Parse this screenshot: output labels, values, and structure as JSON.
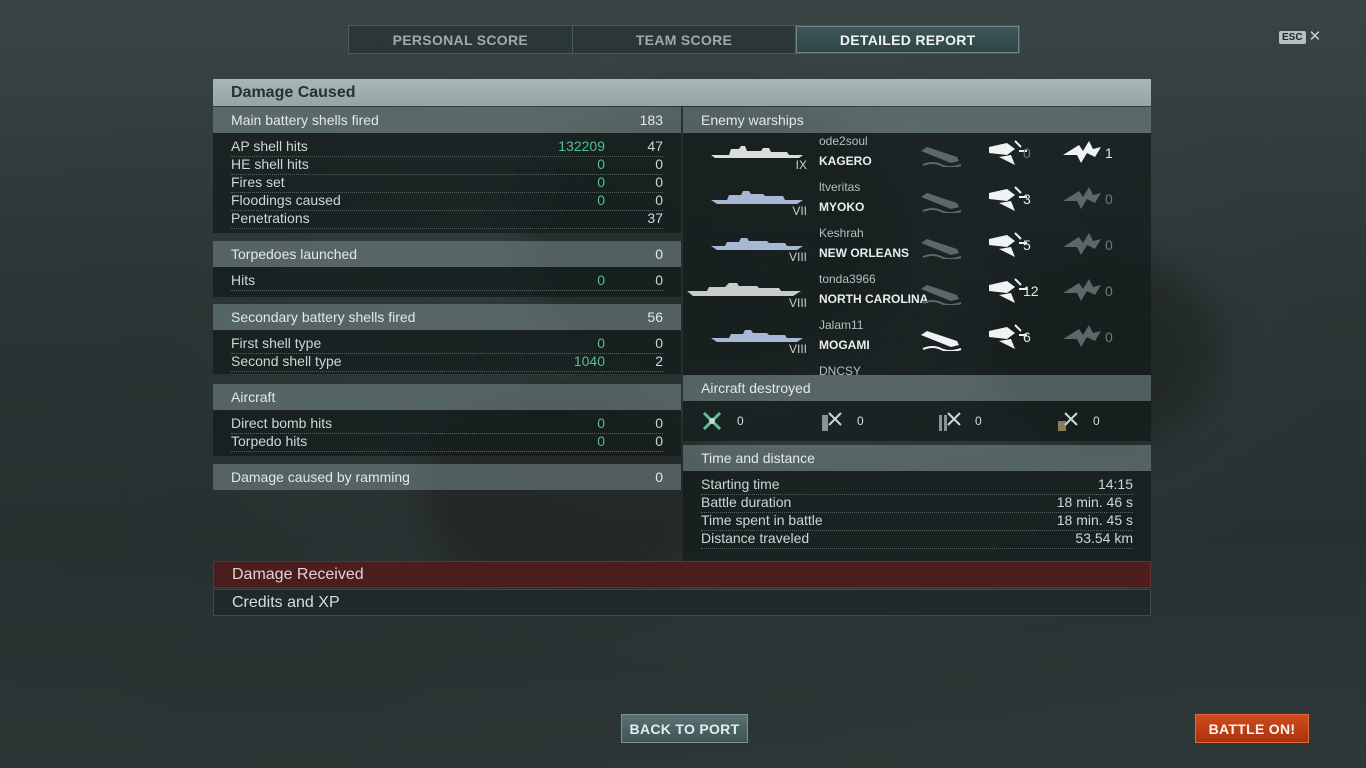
{
  "tabs": [
    "PERSONAL SCORE",
    "TEAM SCORE",
    "DETAILED REPORT"
  ],
  "esc": {
    "key": "ESC",
    "close": "✕"
  },
  "damage_caused": {
    "title": "Damage Caused",
    "main_battery": {
      "header": {
        "label": "Main battery shells fired",
        "value": "183"
      },
      "rows": [
        {
          "label": "AP shell hits",
          "green": "132209",
          "value": "47"
        },
        {
          "label": "HE shell hits",
          "green": "0",
          "value": "0"
        },
        {
          "label": "Fires set",
          "green": "0",
          "value": "0"
        },
        {
          "label": "Floodings caused",
          "green": "0",
          "value": "0"
        },
        {
          "label": "Penetrations",
          "green": "",
          "value": "37"
        }
      ]
    },
    "torpedoes": {
      "header": {
        "label": "Torpedoes launched",
        "value": "0"
      },
      "rows": [
        {
          "label": "Hits",
          "green": "0",
          "value": "0"
        }
      ]
    },
    "secondary": {
      "header": {
        "label": "Secondary battery shells fired",
        "value": "56"
      },
      "rows": [
        {
          "label": "First shell type",
          "green": "0",
          "value": "0"
        },
        {
          "label": "Second shell type",
          "green": "1040",
          "value": "2"
        }
      ]
    },
    "aircraft": {
      "header": {
        "label": "Aircraft",
        "value": ""
      },
      "rows": [
        {
          "label": "Direct bomb hits",
          "green": "0",
          "value": "0"
        },
        {
          "label": "Torpedo hits",
          "green": "0",
          "value": "0"
        }
      ]
    },
    "ramming": {
      "label": "Damage caused by ramming",
      "value": "0"
    }
  },
  "enemy_warships": {
    "title": "Enemy warships",
    "ships": [
      {
        "player": "ode2soul",
        "tier": "IX",
        "name": "KAGERO",
        "hits": "0",
        "crits": "1"
      },
      {
        "player": "ltveritas",
        "tier": "VII",
        "name": "MYOKO",
        "hits": "3",
        "crits": "0"
      },
      {
        "player": "Keshrah",
        "tier": "VIII",
        "name": "NEW ORLEANS",
        "hits": "5",
        "crits": "0"
      },
      {
        "player": "tonda3966",
        "tier": "VIII",
        "name": "NORTH CAROLINA",
        "hits": "12",
        "crits": "0"
      },
      {
        "player": "Jalam11",
        "tier": "VIII",
        "name": "MOGAMI",
        "hits": "6",
        "crits": "0"
      },
      {
        "player": "DNCSY",
        "tier": "",
        "name": "",
        "hits": "",
        "crits": ""
      }
    ]
  },
  "aircraft_destroyed": {
    "title": "Aircraft destroyed",
    "items": [
      {
        "icon": "fighter-plane-icon",
        "value": "0"
      },
      {
        "icon": "torpedo-bomber-icon",
        "value": "0"
      },
      {
        "icon": "dive-bomber-icon",
        "value": "0"
      },
      {
        "icon": "spotter-plane-icon",
        "value": "0"
      }
    ]
  },
  "time_distance": {
    "title": "Time and distance",
    "rows": [
      {
        "label": "Starting time",
        "value": "14:15"
      },
      {
        "label": "Battle duration",
        "value": "18 min. 46 s"
      },
      {
        "label": "Time spent in battle",
        "value": "18 min. 45 s"
      },
      {
        "label": "Distance traveled",
        "value": "53.54 km"
      }
    ]
  },
  "damage_received": {
    "title": "Damage Received"
  },
  "credits_xp": {
    "title": "Credits and XP"
  },
  "buttons": {
    "back": "BACK TO PORT",
    "battle": "BATTLE ON!"
  },
  "colors": {
    "green_value": "#53c08f",
    "battle_button": "#c0401a",
    "damage_received_bar": "#501a1a"
  }
}
